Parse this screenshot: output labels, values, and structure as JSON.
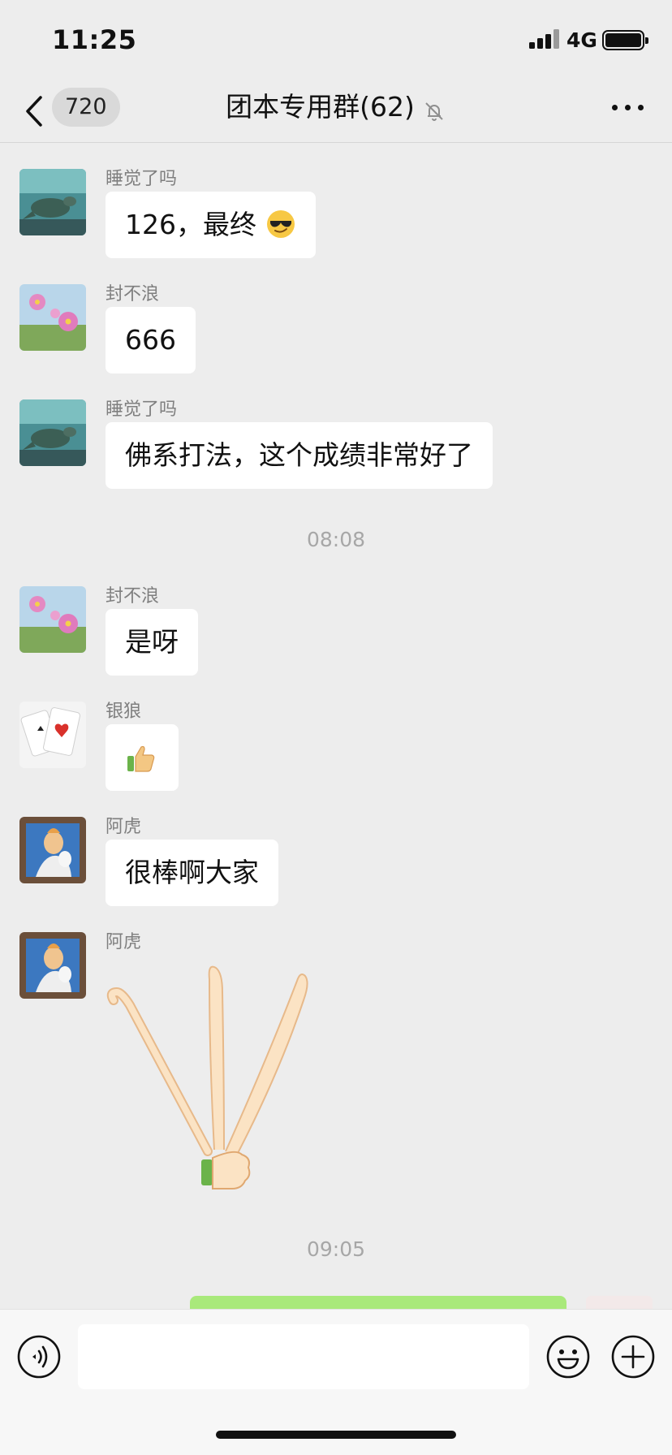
{
  "status_bar": {
    "time": "11:25",
    "network": "4G"
  },
  "nav": {
    "unread_count": "720",
    "title": "团本专用群(62)"
  },
  "messages": [
    {
      "sender": "睡觉了吗",
      "text": "126，最终"
    },
    {
      "sender": "封不浪",
      "text": "666"
    },
    {
      "sender": "睡觉了吗",
      "text": "佛系打法，这个成绩非常好了"
    },
    {
      "sender": "封不浪",
      "text": "是呀"
    },
    {
      "sender": "银狼",
      "text": ""
    },
    {
      "sender": "阿虎",
      "text": "很棒啊大家"
    },
    {
      "sender": "阿虎",
      "text": ""
    }
  ],
  "timestamps": [
    "08:08",
    "09:05"
  ],
  "icons": {
    "back": "chevron-left-icon",
    "mute": "bell-slash-icon",
    "more": "ellipsis-icon",
    "sunglasses_emoji": "sunglasses-emoji-icon",
    "thumbs_up": "thumbs-up-icon",
    "voice": "voice-icon",
    "emoji": "smiley-icon",
    "plus": "plus-icon"
  },
  "colors": {
    "background": "#ededed",
    "bubble": "#ffffff",
    "self_bubble": "#a9e97b",
    "meta_text": "#a7a7a7"
  }
}
